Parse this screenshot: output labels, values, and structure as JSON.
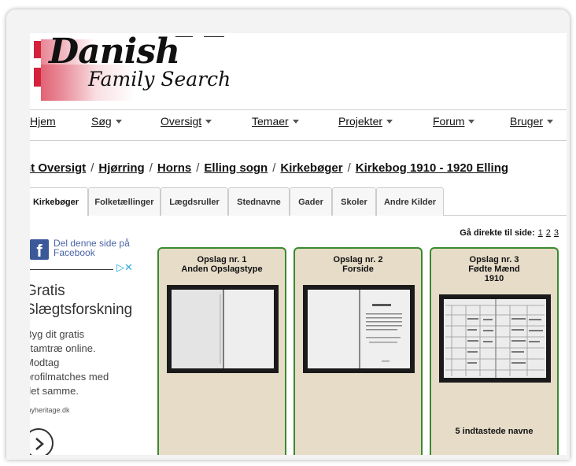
{
  "logo": {
    "line1": "Danish",
    "line2": "Family Search"
  },
  "nav": {
    "items": [
      {
        "label": "Hjem",
        "caret": false
      },
      {
        "label": "Søg",
        "caret": true
      },
      {
        "label": "Oversigt",
        "caret": true
      },
      {
        "label": "Temaer",
        "caret": true
      },
      {
        "label": "Projekter",
        "caret": true
      },
      {
        "label": "Forum",
        "caret": true
      },
      {
        "label": "Bruger",
        "caret": true
      }
    ]
  },
  "breadcrumb": [
    "nt Oversigt",
    "Hjørring",
    "Horns",
    "Elling sogn",
    "Kirkebøger",
    "Kirkebog 1910 - 1920 Elling"
  ],
  "breadcrumb_sep": "/",
  "tabs": [
    "Kirkebøger",
    "Folketællinger",
    "Lægdsruller",
    "Stednavne",
    "Gader",
    "Skoler",
    "Andre Kilder"
  ],
  "pagination": {
    "label": "Gå direkte til side:",
    "pages": [
      "1",
      "2",
      "3"
    ]
  },
  "facebook": {
    "line1": "Del denne side på",
    "line2": "Facebook"
  },
  "ad": {
    "title1": "Gratis",
    "title2": "Slægtsforskning",
    "body": [
      "Byg dit gratis",
      "stamtræ online.",
      "Modtag",
      "profilmatches med",
      "det samme."
    ],
    "domain": "myheritage.dk"
  },
  "cards": [
    {
      "line1": "Opslag nr. 1",
      "line2": "Anden Opslagstype",
      "line3": "",
      "note": ""
    },
    {
      "line1": "Opslag nr. 2",
      "line2": "Forside",
      "line3": "",
      "note": ""
    },
    {
      "line1": "Opslag nr. 3",
      "line2": "Fødte Mænd",
      "line3": "1910",
      "note": "5 indtastede navne"
    }
  ]
}
